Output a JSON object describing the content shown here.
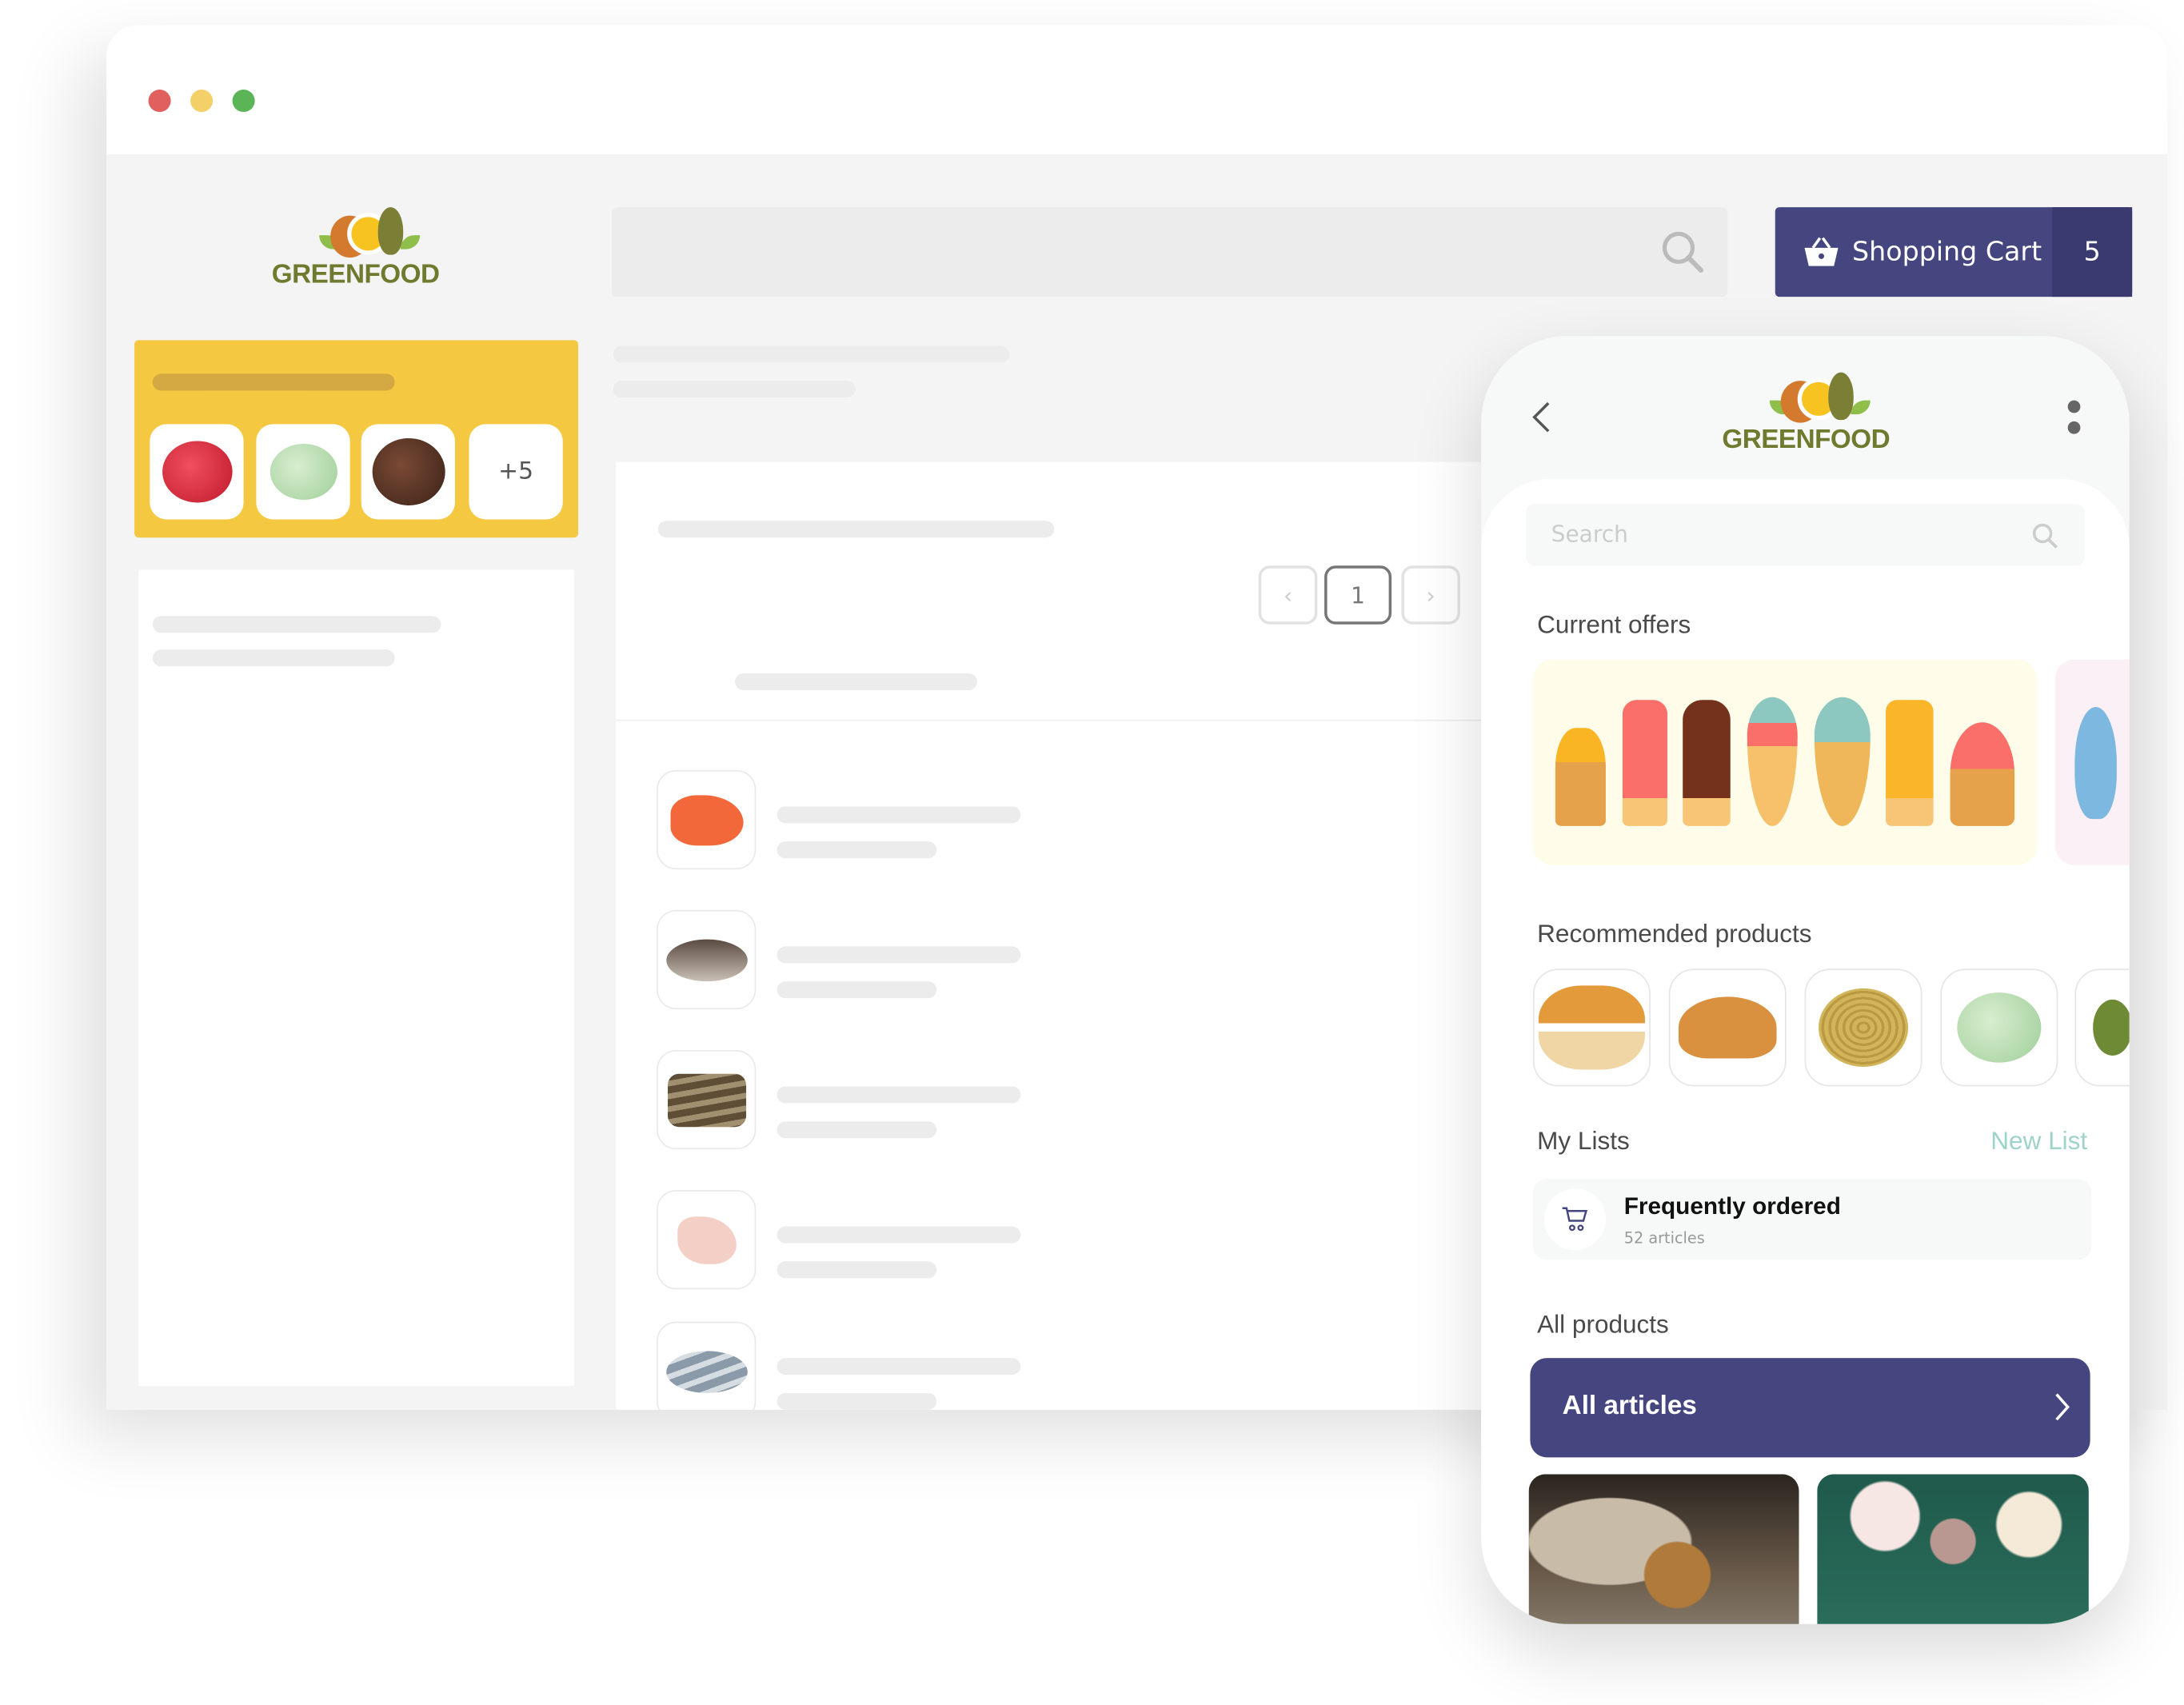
{
  "browser": {
    "window_controls": [
      "close",
      "minimize",
      "maximize"
    ],
    "colors": {
      "close": "#e0605e",
      "minimize": "#f4d069",
      "maximize": "#5bb556"
    }
  },
  "header": {
    "logo_text": "GREENFOOD",
    "search_icon": "search-icon",
    "cart": {
      "label": "Shopping Cart",
      "count": "5",
      "icon": "basket-icon",
      "color": "#45457f"
    }
  },
  "sidebar": {
    "featured_more": "+5",
    "featured_color": "#f5c842",
    "featured_items": [
      "strawberry-ice-cream",
      "pistachio-ice-cream",
      "chocolate-ice-cream"
    ]
  },
  "main": {
    "pagination": {
      "current": "1"
    },
    "products": [
      "salmon",
      "flounder",
      "shrimp",
      "fish-fillet",
      "sardines"
    ]
  },
  "mobile": {
    "logo_text": "GREENFOOD",
    "search_placeholder": "Search",
    "current_offers": "Current offers",
    "recommended": "Recommended products",
    "recommended_items": [
      "burger-bun",
      "croissants",
      "pasta",
      "pistachio-ice-cream",
      "avocado"
    ],
    "my_lists": "My Lists",
    "new_list": "New List",
    "list": {
      "title": "Frequently ordered",
      "subtitle": "52 articles"
    },
    "all_products": "All products",
    "all_articles": "All articles",
    "accent": "#45457f",
    "link_color": "#9dd3c8"
  }
}
